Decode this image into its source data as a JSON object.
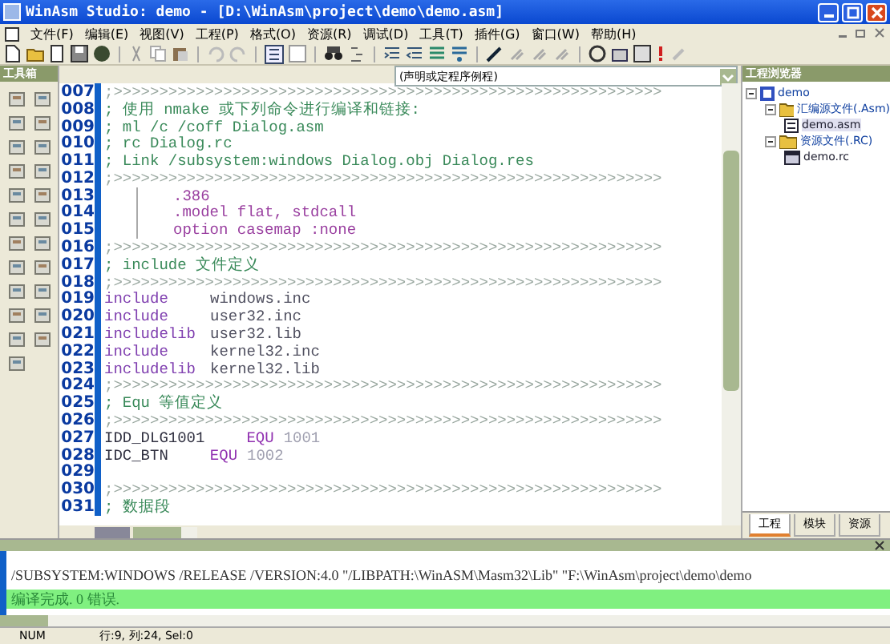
{
  "window": {
    "title": "WinAsm Studio: demo - [D:\\WinAsm\\project\\demo\\demo.asm]"
  },
  "menu": [
    "文件(F)",
    "编辑(E)",
    "视图(V)",
    "工程(P)",
    "格式(O)",
    "资源(R)",
    "调试(D)",
    "工具(T)",
    "插件(G)",
    "窗口(W)",
    "帮助(H)"
  ],
  "toolbox": {
    "title": "工具箱"
  },
  "editor": {
    "procedure_combo": "(声明或定程序例程)",
    "lines": [
      {
        "number": "007",
        "kind": "separator",
        "text": ";>>>>>>>>>>>>>>>>>>>>>>>>>>>>>>>>>>>>>>>>>>>>>>>>>>>>>>>>>>>>"
      },
      {
        "number": "008",
        "kind": "comment",
        "text": "; 使用 nmake 或下列命令进行编译和链接:"
      },
      {
        "number": "009",
        "kind": "comment",
        "text": "; ml /c /coff Dialog.asm"
      },
      {
        "number": "010",
        "kind": "comment",
        "text": "; rc Dialog.rc"
      },
      {
        "number": "011",
        "kind": "comment",
        "text": "; Link /subsystem:windows Dialog.obj Dialog.res"
      },
      {
        "number": "012",
        "kind": "separator",
        "text": ";>>>>>>>>>>>>>>>>>>>>>>>>>>>>>>>>>>>>>>>>>>>>>>>>>>>>>>>>>>>>"
      },
      {
        "number": "013",
        "kind": "directive",
        "text": ".386"
      },
      {
        "number": "014",
        "kind": "directive",
        "text": ".model flat, stdcall"
      },
      {
        "number": "015",
        "kind": "directive",
        "text": "option casemap :none"
      },
      {
        "number": "016",
        "kind": "separator",
        "text": ";>>>>>>>>>>>>>>>>>>>>>>>>>>>>>>>>>>>>>>>>>>>>>>>>>>>>>>>>>>>>"
      },
      {
        "number": "017",
        "kind": "comment",
        "text": "; include 文件定义"
      },
      {
        "number": "018",
        "kind": "separator",
        "text": ";>>>>>>>>>>>>>>>>>>>>>>>>>>>>>>>>>>>>>>>>>>>>>>>>>>>>>>>>>>>>"
      },
      {
        "number": "019",
        "kind": "include",
        "keyword": "include",
        "value": "windows.inc"
      },
      {
        "number": "020",
        "kind": "include",
        "keyword": "include",
        "value": "user32.inc"
      },
      {
        "number": "021",
        "kind": "include",
        "keyword": "includelib",
        "value": "user32.lib"
      },
      {
        "number": "022",
        "kind": "include",
        "keyword": "include",
        "value": "kernel32.inc"
      },
      {
        "number": "023",
        "kind": "include",
        "keyword": "includelib",
        "value": "kernel32.lib"
      },
      {
        "number": "024",
        "kind": "separator",
        "text": ";>>>>>>>>>>>>>>>>>>>>>>>>>>>>>>>>>>>>>>>>>>>>>>>>>>>>>>>>>>>>"
      },
      {
        "number": "025",
        "kind": "comment",
        "text": "; Equ 等值定义"
      },
      {
        "number": "026",
        "kind": "separator",
        "text": ";>>>>>>>>>>>>>>>>>>>>>>>>>>>>>>>>>>>>>>>>>>>>>>>>>>>>>>>>>>>>"
      },
      {
        "number": "027",
        "kind": "equ",
        "name": "IDD_DLG1001",
        "op": "EQU",
        "value": "1001"
      },
      {
        "number": "028",
        "kind": "equ",
        "name": "IDC_BTN",
        "op": "EQU",
        "value": "1002"
      },
      {
        "number": "029",
        "kind": "blank"
      },
      {
        "number": "030",
        "kind": "separator",
        "text": ";>>>>>>>>>>>>>>>>>>>>>>>>>>>>>>>>>>>>>>>>>>>>>>>>>>>>>>>>>>>>"
      },
      {
        "number": "031",
        "kind": "comment",
        "text": "; 数据段"
      }
    ]
  },
  "project_explorer": {
    "title": "工程浏览器",
    "tree": [
      {
        "label": "demo",
        "kind": "project",
        "expanded": true,
        "children": [
          {
            "label": "汇编源文件(.Asm)",
            "kind": "folder",
            "expanded": true,
            "children": [
              {
                "label": "demo.asm",
                "kind": "asm",
                "selected": true
              }
            ]
          },
          {
            "label": "资源文件(.RC)",
            "kind": "folder",
            "expanded": true,
            "children": [
              {
                "label": "demo.rc",
                "kind": "rc",
                "selected": false
              }
            ]
          }
        ]
      }
    ],
    "tabs": [
      {
        "label": "工程",
        "selected": true
      },
      {
        "label": "模块",
        "selected": false
      },
      {
        "label": "资源",
        "selected": false
      }
    ]
  },
  "output": {
    "lines": [
      {
        "text": "/SUBSYSTEM:WINDOWS /RELEASE /VERSION:4.0 \"/LIBPATH:\\WinASM\\Masm32\\Lib\" \"F:\\WinAsm\\project\\demo\\demo",
        "highlighted": false
      },
      {
        "text": "编译完成. 0 错误.",
        "highlighted": true
      }
    ]
  },
  "status_bar": {
    "mode": "NUM",
    "position": "行:9, 列:24, Sel:0"
  }
}
